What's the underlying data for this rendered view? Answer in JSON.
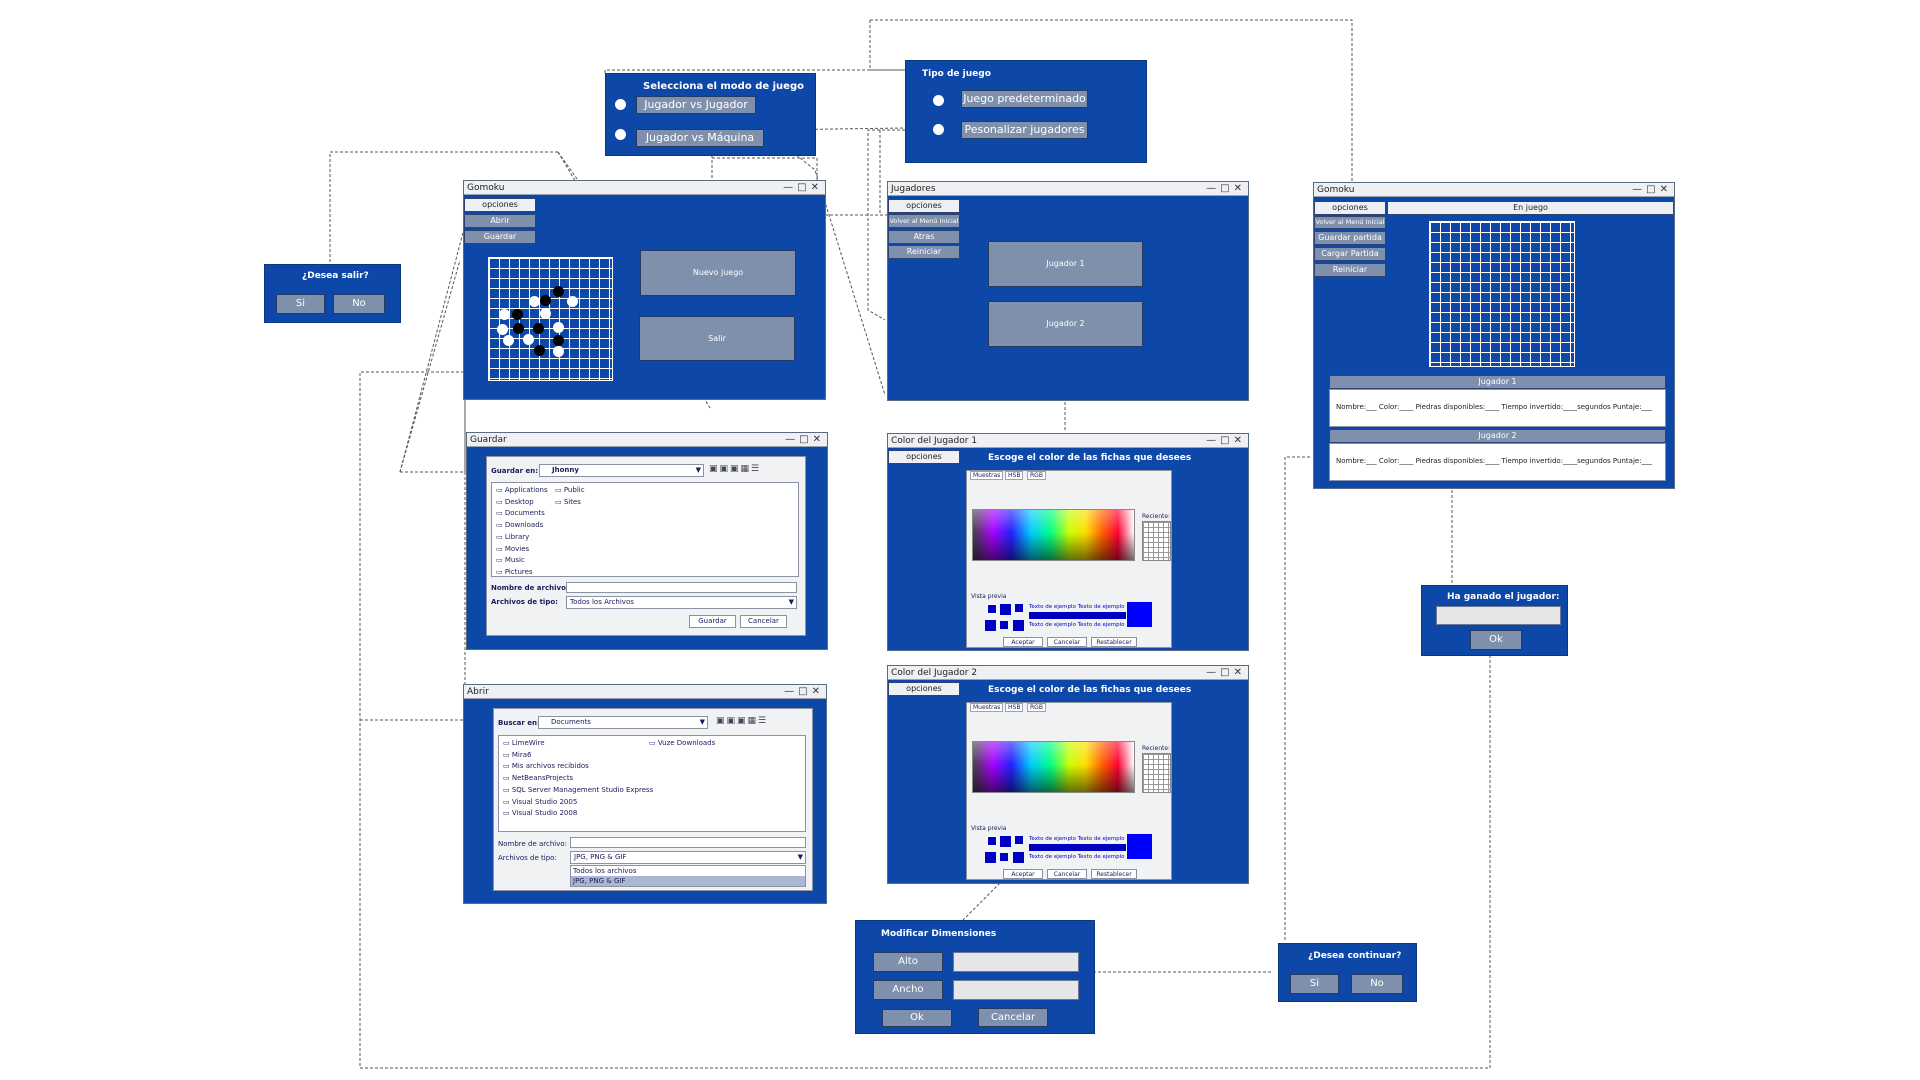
{
  "modo": {
    "title": "Selecciona el modo de juego",
    "opt1": "Jugador vs Jugador",
    "opt2": "Jugador vs Máquina"
  },
  "tipo": {
    "title": "Tipo de juego",
    "opt1": "Juego predeterminado",
    "opt2": "Pesonalizar jugadores"
  },
  "salir_dialog": {
    "title": "¿Desea salir?",
    "yes": "Si",
    "no": "No"
  },
  "gomoku_main": {
    "title": "Gomoku",
    "menu": [
      "opciones",
      "Abrir",
      "Guardar"
    ],
    "new_game": "Nuevo juego",
    "exit": "Salir"
  },
  "jugadores": {
    "title": "Jugadores",
    "menu": [
      "opciones",
      "Volver al Menú Inicial",
      "Atras",
      "Reiniciar"
    ],
    "p1": "Jugador 1",
    "p2": "Jugador 2"
  },
  "gomoku_game": {
    "title": "Gomoku",
    "menu": [
      "opciones",
      "Volver al Menú Inicial",
      "Guardar partida",
      "Cargar Partida",
      "Reiniciar"
    ],
    "status": "En juego",
    "p1": "Jugador 1",
    "p2": "Jugador 2",
    "info": "Nombre:___ Color:____ Piedras disponibles:____ Tiempo invertido:____segundos Puntaje:___"
  },
  "guardar": {
    "title": "Guardar",
    "save_in_label": "Guardar en:",
    "save_in_value": "Jhonny",
    "files_col1": [
      "Applications",
      "Desktop",
      "Documents",
      "Downloads",
      "Library",
      "Movies",
      "Music",
      "Pictures"
    ],
    "files_col2": [
      "Public",
      "Sites"
    ],
    "filename_label": "Nombre de archivo:",
    "filetype_label": "Archivos de tipo:",
    "filetype_value": "Todos los Archivos",
    "save_btn": "Guardar",
    "cancel_btn": "Cancelar"
  },
  "abrir": {
    "title": "Abrir",
    "look_in_label": "Buscar en:",
    "look_in_value": "Documents",
    "files_col1": [
      "LimeWire",
      "Mira6",
      "Mis archivos recibidos",
      "NetBeansProjects",
      "SQL Server Management Studio Express",
      "Visual Studio 2005",
      "Visual Studio 2008"
    ],
    "files_col2": [
      "Vuze Downloads"
    ],
    "filename_label": "Nombre de archivo:",
    "filetype_label": "Archivos de tipo:",
    "filetype_value": "JPG, PNG & GIF",
    "dropdown": [
      "Todos los archivos",
      "JPG, PNG & GIF"
    ]
  },
  "color1": {
    "title": "Color del Jugador 1",
    "menu": "opciones",
    "heading": "Escoge el color de las fichas que desees",
    "tabs": [
      "Muestras",
      "HSB",
      "RGB"
    ],
    "recent": "Reciente:",
    "preview": "Vista previa",
    "sample": "Texto de ejemplo  Texto de ejemplo",
    "accept": "Aceptar",
    "cancel": "Cancelar",
    "reset": "Restablecer"
  },
  "color2": {
    "title": "Color del Jugador 2",
    "menu": "opciones",
    "heading": "Escoge el color de las fichas que desees",
    "tabs": [
      "Muestras",
      "HSB",
      "RGB"
    ],
    "recent": "Reciente:",
    "preview": "Vista previa",
    "sample": "Texto de ejemplo  Texto de ejemplo",
    "accept": "Aceptar",
    "cancel": "Cancelar",
    "reset": "Restablecer"
  },
  "dimensiones": {
    "title": "Modificar Dimensiones",
    "alto": "Alto",
    "ancho": "Ancho",
    "ok": "Ok",
    "cancel": "Cancelar"
  },
  "continuar": {
    "title": "¿Desea continuar?",
    "yes": "Si",
    "no": "No"
  },
  "ganador": {
    "title": "Ha ganado el jugador:",
    "ok": "Ok"
  },
  "colors": {
    "panel": "#0d47a8",
    "button": "#7f90ad",
    "stone_black": "#000000",
    "stone_white": "#ffffff"
  }
}
